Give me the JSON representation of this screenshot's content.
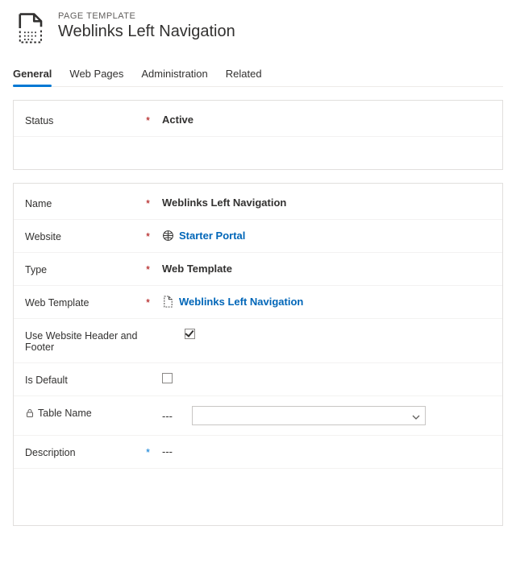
{
  "header": {
    "eyebrow": "PAGE TEMPLATE",
    "title": "Weblinks Left Navigation"
  },
  "tabs": [
    {
      "label": "General",
      "active": true
    },
    {
      "label": "Web Pages",
      "active": false
    },
    {
      "label": "Administration",
      "active": false
    },
    {
      "label": "Related",
      "active": false
    }
  ],
  "statusPanel": {
    "label": "Status",
    "value": "Active"
  },
  "fields": {
    "name": {
      "label": "Name",
      "value": "Weblinks Left Navigation"
    },
    "website": {
      "label": "Website",
      "value": "Starter Portal"
    },
    "type": {
      "label": "Type",
      "value": "Web Template"
    },
    "webTemplate": {
      "label": "Web Template",
      "value": "Weblinks Left Navigation"
    },
    "useHeader": {
      "label": "Use Website Header and Footer",
      "checked": true
    },
    "isDefault": {
      "label": "Is Default",
      "checked": false
    },
    "tableName": {
      "label": "Table Name",
      "value": "---"
    },
    "description": {
      "label": "Description",
      "value": "---"
    }
  },
  "glyphs": {
    "required": "*",
    "recommended": "*"
  }
}
